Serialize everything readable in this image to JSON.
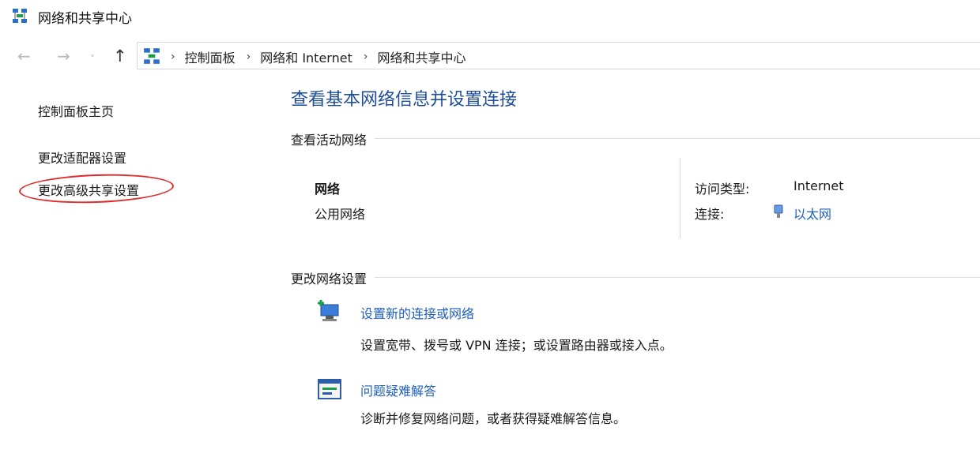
{
  "window": {
    "title": "网络和共享中心"
  },
  "nav": {
    "back_icon": "←",
    "forward_icon": "→",
    "dropdown_icon": "˅",
    "up_icon": "↑",
    "crumb_sep": "›",
    "breadcrumbs": [
      "控制面板",
      "网络和 Internet",
      "网络和共享中心"
    ]
  },
  "sidebar": {
    "items": [
      {
        "label": "控制面板主页"
      },
      {
        "label": "更改适配器设置"
      },
      {
        "label": "更改高级共享设置"
      }
    ]
  },
  "main": {
    "title": "查看基本网络信息并设置连接",
    "active_section": "查看活动网络",
    "network": {
      "name": "网络",
      "type": "公用网络",
      "access_label": "访问类型:",
      "access_value": "Internet",
      "connection_label": "连接:",
      "connection_value": "以太网"
    },
    "change_section": "更改网络设置",
    "tasks": [
      {
        "link": "设置新的连接或网络",
        "desc": "设置宽带、拨号或 VPN 连接；或设置路由器或接入点。"
      },
      {
        "link": "问题疑难解答",
        "desc": "诊断并修复网络问题，或者获得疑难解答信息。"
      }
    ]
  },
  "colors": {
    "link": "#1f5fbf",
    "title": "#1f4e99",
    "highlight_oval": "#e02a2a"
  }
}
